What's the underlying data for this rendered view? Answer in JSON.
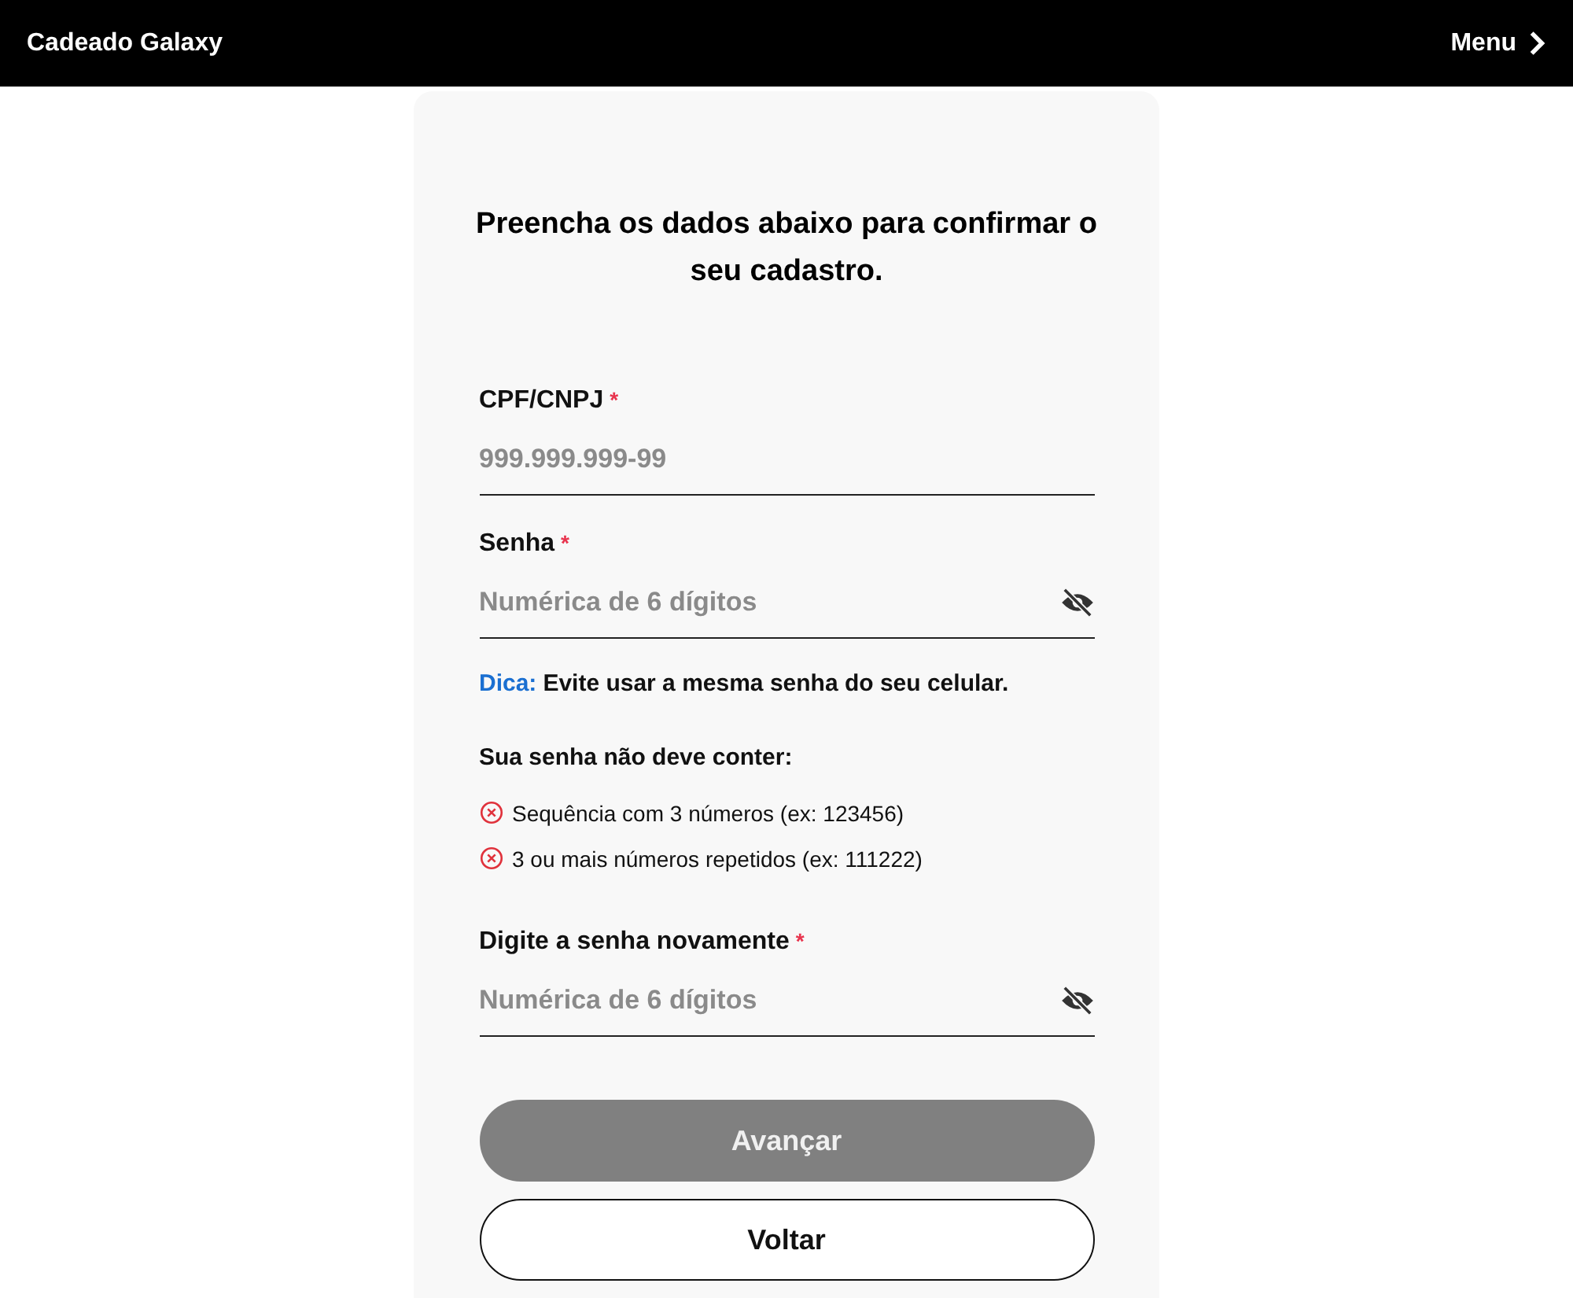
{
  "header": {
    "title": "Cadeado Galaxy",
    "menu_label": "Menu"
  },
  "form": {
    "heading": "Preencha os dados abaixo para confirmar o seu cadastro.",
    "fields": [
      {
        "label": "CPF/CNPJ",
        "required_mark": "*",
        "placeholder": "999.999.999-99",
        "kind": "text"
      },
      {
        "label": "Senha",
        "required_mark": "*",
        "placeholder": "Numérica de 6 dígitos",
        "kind": "password",
        "password_visible": false
      },
      {
        "label": "Digite a senha novamente",
        "required_mark": "*",
        "placeholder": "Numérica de 6 dígitos",
        "kind": "password",
        "password_visible": false
      }
    ],
    "hint": {
      "label": "Dica:",
      "text": "Evite usar a mesma senha do seu celular."
    },
    "rules_title": "Sua senha não deve conter:",
    "rules": [
      {
        "text": "Sequência com 3 números (ex: 123456)",
        "kind": "error"
      },
      {
        "text": "3 ou mais números repetidos (ex: 111222)",
        "kind": "error"
      }
    ],
    "buttons": [
      {
        "label": "Avançar",
        "kind": "primary",
        "disabled": true
      },
      {
        "label": "Voltar",
        "kind": "outline",
        "disabled": false
      }
    ]
  }
}
